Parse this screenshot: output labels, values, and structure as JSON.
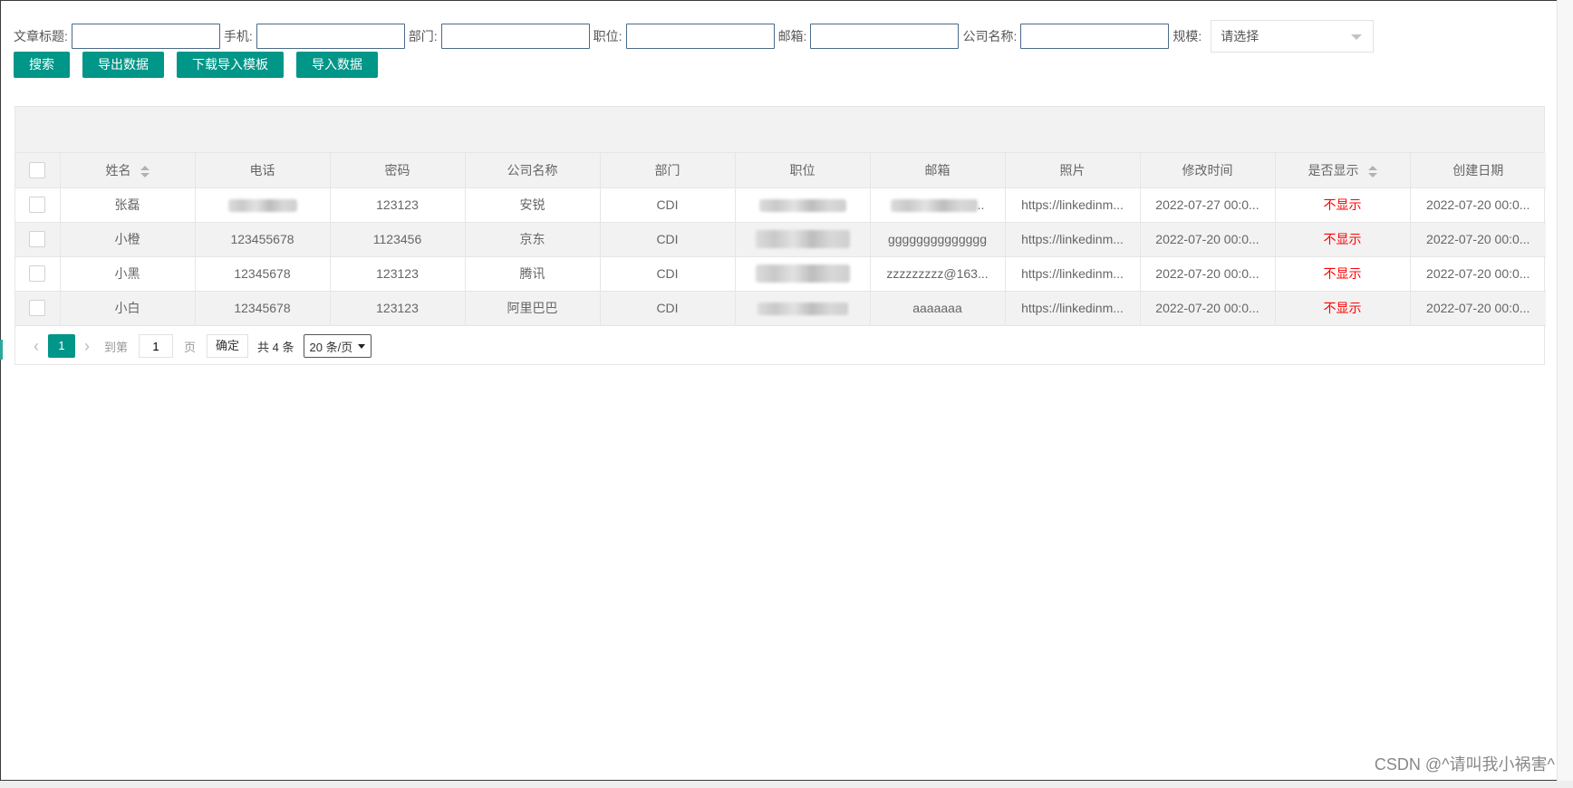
{
  "filters": [
    {
      "label": "文章标题:",
      "value": ""
    },
    {
      "label": "手机:",
      "value": ""
    },
    {
      "label": "部门:",
      "value": ""
    },
    {
      "label": "职位:",
      "value": ""
    },
    {
      "label": "邮箱:",
      "value": ""
    },
    {
      "label": "公司名称:",
      "value": ""
    }
  ],
  "scale_filter": {
    "label": "规模:",
    "placeholder": "请选择"
  },
  "buttons": {
    "search": "搜索",
    "export": "导出数据",
    "download_template": "下载导入模板",
    "import": "导入数据"
  },
  "table": {
    "headers": [
      "姓名",
      "电话",
      "密码",
      "公司名称",
      "部门",
      "职位",
      "邮箱",
      "照片",
      "修改时间",
      "是否显示",
      "创建日期"
    ],
    "rows": [
      {
        "name": "张磊",
        "phone": "",
        "password": "123123",
        "company": "安锐",
        "dept": "CDI",
        "position": "",
        "email": "..",
        "photo": "https://linkedinm...",
        "modified": "2022-07-27 00:0...",
        "show": "不显示",
        "created": "2022-07-20 00:0..."
      },
      {
        "name": "小橙",
        "phone": "123455678",
        "password": "1123456",
        "company": "京东",
        "dept": "CDI",
        "position": "",
        "email": "gggggggggggggg",
        "photo": "https://linkedinm...",
        "modified": "2022-07-20 00:0...",
        "show": "不显示",
        "created": "2022-07-20 00:0..."
      },
      {
        "name": "小黑",
        "phone": "12345678",
        "password": "123123",
        "company": "腾讯",
        "dept": "CDI",
        "position": "",
        "email": "zzzzzzzzz@163...",
        "photo": "https://linkedinm...",
        "modified": "2022-07-20 00:0...",
        "show": "不显示",
        "created": "2022-07-20 00:0..."
      },
      {
        "name": "小白",
        "phone": "12345678",
        "password": "123123",
        "company": "阿里巴巴",
        "dept": "CDI",
        "position": "",
        "email": "aaaaaaa",
        "photo": "https://linkedinm...",
        "modified": "2022-07-20 00:0...",
        "show": "不显示",
        "created": "2022-07-20 00:0..."
      }
    ]
  },
  "pager": {
    "current": "1",
    "goto_label": "到第",
    "page_value": "1",
    "page_unit": "页",
    "confirm": "确定",
    "total": "共 4 条",
    "page_size": "20 条/页"
  },
  "watermark": "CSDN @^请叫我小祸害^",
  "colors": {
    "accent": "#009688",
    "hidden_status": "#ff0000"
  }
}
